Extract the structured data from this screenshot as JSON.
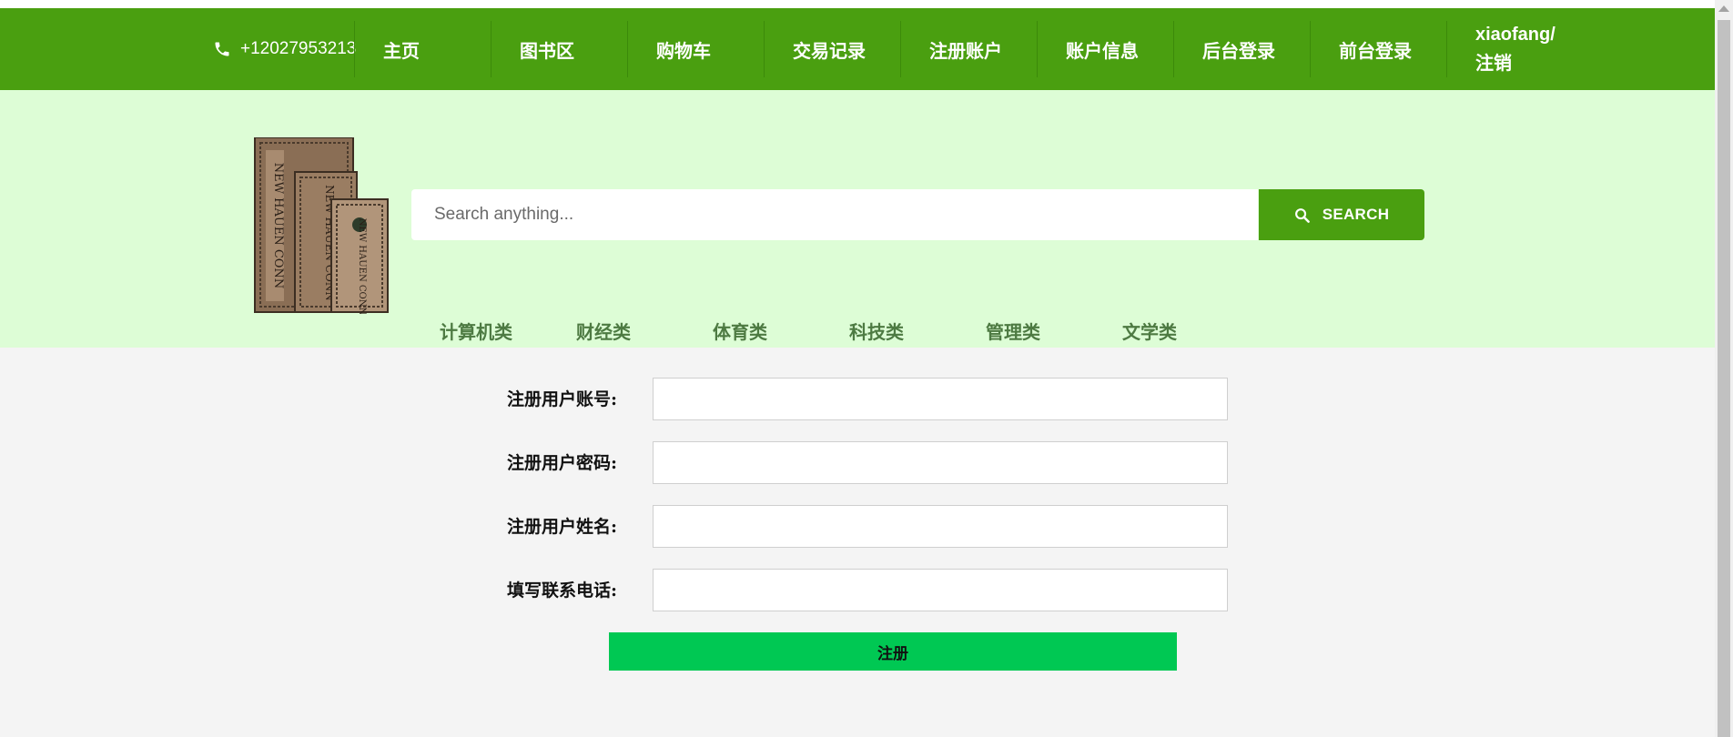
{
  "nav": {
    "phone": "+12027953213",
    "items": [
      "主页",
      "图书区",
      "购物车",
      "交易记录",
      "注册账户",
      "账户信息",
      "后台登录",
      "前台登录"
    ],
    "user_line1": "xiaofang/",
    "user_line2": "注销"
  },
  "search": {
    "placeholder": "Search anything...",
    "button_label": "SEARCH"
  },
  "categories": [
    "计算机类",
    "财经类",
    "体育类",
    "科技类",
    "管理类",
    "文学类"
  ],
  "books_image": {
    "title_text": "NEW HAUEN CONN"
  },
  "form": {
    "fields": [
      {
        "label": "注册用户账号:",
        "value": ""
      },
      {
        "label": "注册用户密码:",
        "value": ""
      },
      {
        "label": "注册用户姓名:",
        "value": ""
      },
      {
        "label": "填写联系电话:",
        "value": ""
      }
    ],
    "submit_label": "注册"
  },
  "colors": {
    "nav_green": "#4a9f10",
    "header_bg": "#ddfdd6",
    "category_text": "#4d7a42",
    "submit_green": "#00c853",
    "page_bg": "#f4f4f4"
  }
}
